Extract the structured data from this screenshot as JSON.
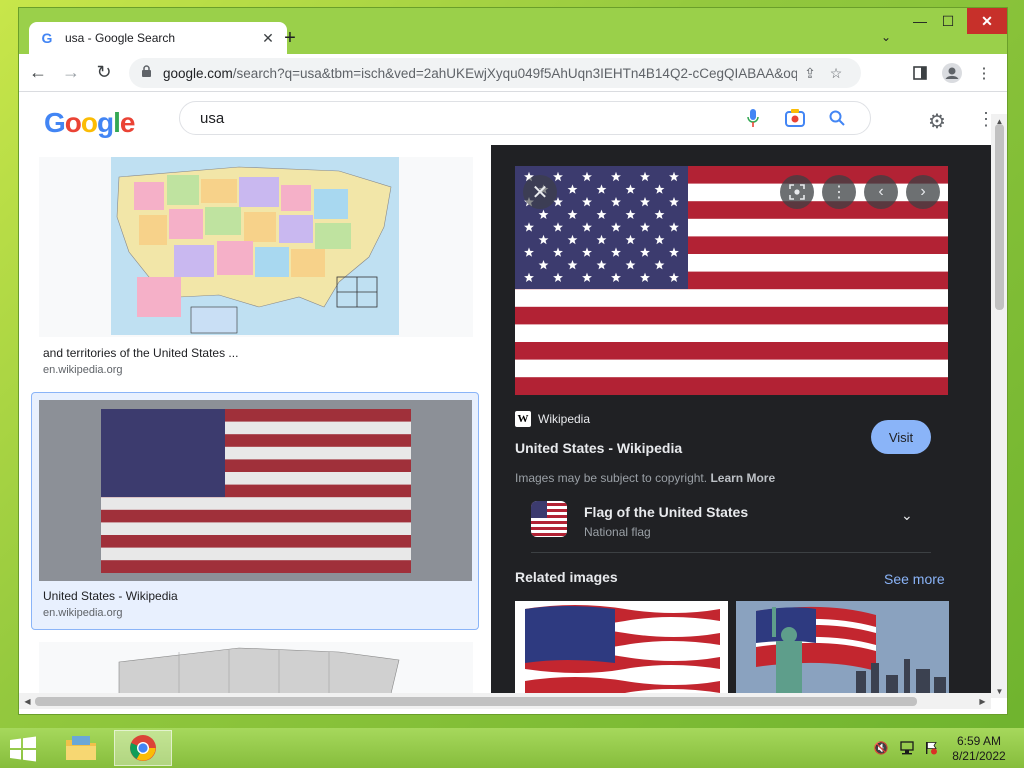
{
  "browser": {
    "tab_title": "usa - Google Search",
    "tab_favicon": "G",
    "url_host": "google.com",
    "url_rest": "/search?q=usa&tbm=isch&ved=2ahUKEwjXyqu049f5AhUqn3IEHTn4B14Q2-cCegQIABAA&oq...",
    "window_controls": {
      "minimize": "—",
      "maximize": "☐",
      "close": "✕"
    }
  },
  "google": {
    "logo_letters": [
      "G",
      "o",
      "o",
      "g",
      "l",
      "e"
    ],
    "search_query": "usa"
  },
  "results": [
    {
      "caption": "and territories of the United States ...",
      "source": "en.wikipedia.org"
    },
    {
      "caption": "United States - Wikipedia",
      "source": "en.wikipedia.org"
    }
  ],
  "viewer": {
    "source_name": "Wikipedia",
    "source_logo": "W",
    "title": "United States - Wikipedia",
    "visit_label": "Visit",
    "copyright_text": "Images may be subject to copyright.",
    "learn_more": "Learn More",
    "kg_title": "Flag of the United States",
    "kg_subtitle": "National flag",
    "related_label": "Related images",
    "see_more": "See more"
  },
  "taskbar": {
    "time": "6:59 AM",
    "date": "8/21/2022"
  },
  "colors": {
    "flag_red": "#b22234",
    "flag_blue": "#3c3b6e",
    "accent_blue": "#8ab4f8",
    "viewer_bg": "#202124"
  }
}
